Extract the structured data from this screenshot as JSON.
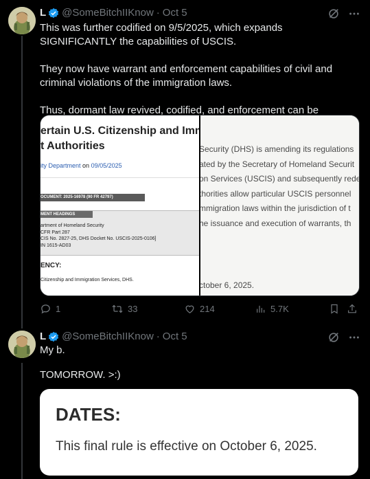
{
  "post1": {
    "display_name": "L",
    "handle": "@SomeBitchIIKnow",
    "separator": "·",
    "date": "Oct 5",
    "paragraphs": [
      "This was further codified on 9/5/2025, which expands SIGNIFICANTLY the capabilities of USCIS.",
      "They now have warrant and enforcement capabilities of civil and criminal violations of the immigration laws.",
      "Thus, dormant law revived, codified, and enforcement can be robust/fast."
    ],
    "media_left": {
      "title_line1": "ertain U.S. Citizenship and Immi",
      "title_line2": "t Authorities",
      "agency_prefix": "ity Department",
      "on_word": "on",
      "date": "09/05/2025",
      "document_bar": "OCUMENT: 2025-16978 (90 FR 42797)",
      "headings_bar": "MENT HEADINGS",
      "heading_lines": [
        "artment of Homeland Security",
        " CFR Part 287",
        "CIS No. 2827-25, DHS Docket No. USCIS-2025-0106]",
        "IN 1615-AD03"
      ],
      "agency_label": "ENCY:",
      "agency_text": "Citizenship and Immigration Services, DHS."
    },
    "media_right": {
      "lines": [
        "Security (DHS) is amending its regulations",
        "ated by the Secretary of Homeland Securit",
        "on Services (USCIS) and subsequently rede",
        "thorities allow particular USCIS personnel",
        "mmigration laws within the jurisdiction of t",
        "he issuance and execution of warrants, th"
      ],
      "bottom_line": "ctober 6, 2025."
    },
    "actions": {
      "replies": "1",
      "reposts": "33",
      "likes": "214",
      "views": "5.7K"
    }
  },
  "post2": {
    "display_name": "L",
    "handle": "@SomeBitchIIKnow",
    "separator": "·",
    "date": "Oct 5",
    "paragraphs": [
      "My b.",
      "TOMORROW. >:)"
    ],
    "card": {
      "heading": "DATES:",
      "body": "This final rule is effective on October 6, 2025."
    }
  },
  "colors": {
    "background": "#000000",
    "text": "#e7e9ea",
    "muted": "#71767b",
    "verified": "#1d9bf0"
  }
}
